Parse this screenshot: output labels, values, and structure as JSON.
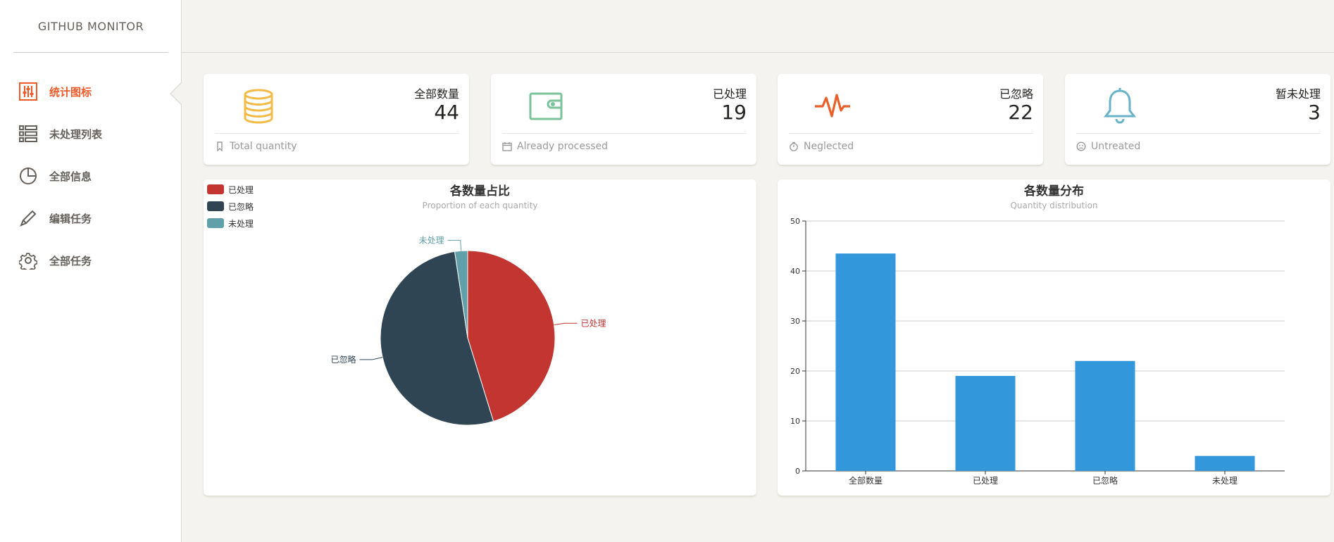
{
  "sidebar": {
    "brand": "GITHUB MONITOR",
    "items": [
      {
        "label": "统计图标",
        "icon": "equalizer-icon",
        "active": true
      },
      {
        "label": "未处理列表",
        "icon": "list-icon",
        "active": false
      },
      {
        "label": "全部信息",
        "icon": "pie-chart-icon",
        "active": false
      },
      {
        "label": "编辑任务",
        "icon": "pencil-icon",
        "active": false
      },
      {
        "label": "全部任务",
        "icon": "gear-icon",
        "active": false
      }
    ]
  },
  "stats": [
    {
      "title": "全部数量",
      "value": "44",
      "footer": "Total quantity",
      "icon": "database-icon",
      "footer_icon": "bookmark-icon",
      "color": "#f3bb45"
    },
    {
      "title": "已处理",
      "value": "19",
      "footer": "Already processed",
      "icon": "wallet-icon",
      "footer_icon": "calendar-icon",
      "color": "#7ac29a"
    },
    {
      "title": "已忽略",
      "value": "22",
      "footer": "Neglected",
      "icon": "pulse-icon",
      "footer_icon": "timer-icon",
      "color": "#eb5e28"
    },
    {
      "title": "暂未处理",
      "value": "3",
      "footer": "Untreated",
      "icon": "bell-icon",
      "footer_icon": "face-icon",
      "color": "#68b3c8"
    }
  ],
  "pie": {
    "title": "各数量占比",
    "subtitle": "Proportion of each quantity"
  },
  "bar": {
    "title": "各数量分布",
    "subtitle": "Quantity distribution"
  },
  "chart_data": [
    {
      "type": "pie",
      "title": "各数量占比",
      "subtitle": "Proportion of each quantity",
      "slices": [
        {
          "name": "已处理",
          "value": 19,
          "color": "#c23531"
        },
        {
          "name": "已忽略",
          "value": 22,
          "color": "#2f4554"
        },
        {
          "name": "未处理",
          "value": 1,
          "color": "#61a0a8"
        }
      ],
      "legend": "top-left"
    },
    {
      "type": "bar",
      "title": "各数量分布",
      "subtitle": "Quantity distribution",
      "categories": [
        "全部数量",
        "已处理",
        "已忽略",
        "未处理"
      ],
      "values": [
        43.5,
        19,
        22,
        3
      ],
      "color": "#3398db",
      "ylim": [
        0,
        50
      ],
      "yticks": [
        0,
        10,
        20,
        30,
        40,
        50
      ],
      "grid": true
    }
  ]
}
